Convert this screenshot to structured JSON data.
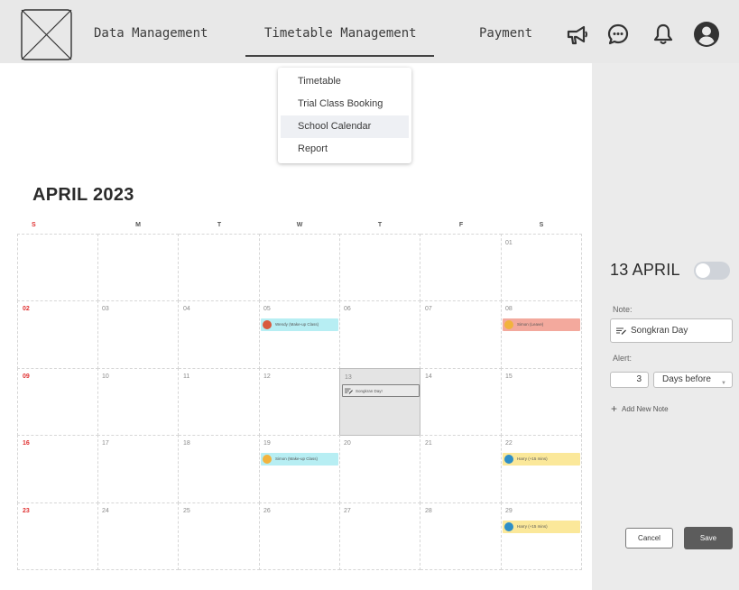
{
  "nav": {
    "items": [
      "Data Management",
      "Timetable Management",
      "Payment"
    ],
    "icons": [
      "megaphone-icon",
      "chat-icon",
      "bell-icon",
      "user-account-icon"
    ]
  },
  "dropdown": {
    "items": [
      "Timetable",
      "Trial Class Booking",
      "School Calendar",
      "Report"
    ],
    "active": "School Calendar"
  },
  "calendar": {
    "month_title": "APRIL 2023",
    "weekdays": [
      "S",
      "M",
      "T",
      "W",
      "T",
      "F",
      "S"
    ],
    "weeks": [
      [
        "",
        "",
        "",
        "",
        "",
        "",
        "01"
      ],
      [
        "02",
        "03",
        "04",
        "05",
        "06",
        "07",
        "08"
      ],
      [
        "09",
        "10",
        "11",
        "12",
        "13",
        "14",
        "15"
      ],
      [
        "16",
        "17",
        "18",
        "19",
        "20",
        "21",
        "22"
      ],
      [
        "23",
        "24",
        "25",
        "26",
        "27",
        "28",
        "29"
      ]
    ],
    "selected_day": "13",
    "events": [
      {
        "week": 1,
        "day": 3,
        "label": "Wendy (Make-up Class)",
        "color": "#b7eef3",
        "avatar_color": "#d9593d",
        "kind": "student"
      },
      {
        "week": 1,
        "day": 6,
        "label": "Simon (Leave)",
        "color": "#f3a99d",
        "avatar_color": "#f2b33d",
        "kind": "student"
      },
      {
        "week": 2,
        "day": 4,
        "label": "Songkran Day!",
        "color": "#eaeaea",
        "kind": "note"
      },
      {
        "week": 3,
        "day": 3,
        "label": "Simon (Make-up Class)",
        "color": "#b7eef3",
        "avatar_color": "#f2b33d",
        "kind": "student"
      },
      {
        "week": 3,
        "day": 6,
        "label": "Harry (+15 mins)",
        "color": "#fbe89a",
        "avatar_color": "#2f8fc7",
        "kind": "student"
      },
      {
        "week": 4,
        "day": 6,
        "label": "Harry (+15 mins)",
        "color": "#fbe89a",
        "avatar_color": "#2f8fc7",
        "kind": "student"
      }
    ],
    "colors": {
      "sunday": "#e03131",
      "selected_bg": "#e4e4e4"
    }
  },
  "panel": {
    "date": "13 APRIL",
    "toggle_on": false,
    "note_label": "Note:",
    "note_value": "Songkran Day",
    "alert_label": "Alert:",
    "alert_value": "3",
    "alert_unit": "Days before",
    "add_note": "Add New Note",
    "cancel": "Cancel",
    "save": "Save"
  }
}
